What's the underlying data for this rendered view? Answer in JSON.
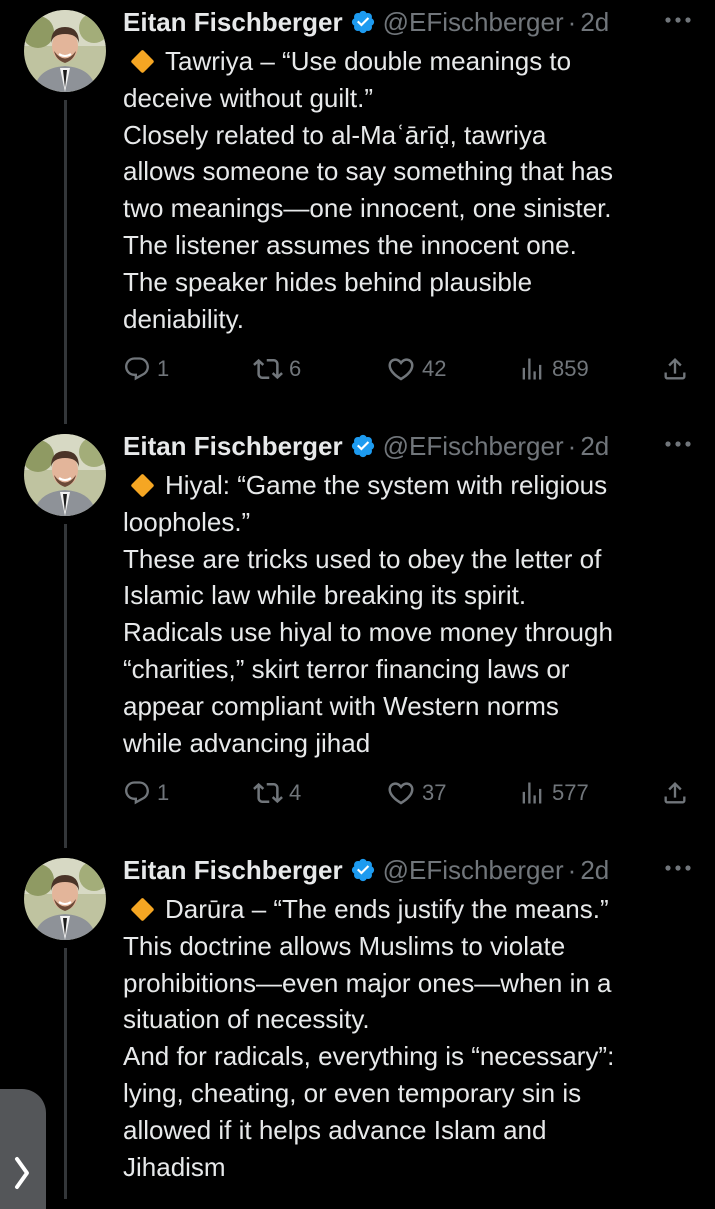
{
  "tweets": [
    {
      "author": {
        "name": "Eitan Fischberger",
        "handle": "@EFischberger",
        "time": "2d"
      },
      "lines": [
        "Tawriya – “Use double meanings to",
        "deceive without guilt.”",
        "Closely related to al-Maʿārīḍ, tawriya",
        "allows someone to say something that has",
        "two meanings—one innocent, one sinister.",
        "The listener assumes the innocent one.",
        "The speaker hides behind plausible",
        "deniability."
      ],
      "stats": {
        "replies": "1",
        "reposts": "6",
        "likes": "42",
        "views": "859"
      }
    },
    {
      "author": {
        "name": "Eitan Fischberger",
        "handle": "@EFischberger",
        "time": "2d"
      },
      "lines": [
        "Hiyal: “Game the system with religious",
        "loopholes.”",
        "These are tricks used to obey the letter of",
        "Islamic law while breaking its spirit.",
        "Radicals use hiyal to move money through",
        "“charities,” skirt terror financing laws or",
        "appear compliant with Western norms",
        "while advancing jihad"
      ],
      "stats": {
        "replies": "1",
        "reposts": "4",
        "likes": "37",
        "views": "577"
      }
    },
    {
      "author": {
        "name": "Eitan Fischberger",
        "handle": "@EFischberger",
        "time": "2d"
      },
      "lines": [
        "Darūra – “The ends justify the means.”",
        "This doctrine allows Muslims to violate",
        "prohibitions—even major ones—when in a",
        "situation of necessity.",
        "And for radicals, everything is “necessary”:",
        "lying, cheating, or even temporary sin is",
        "allowed if it helps advance Islam and",
        "Jihadism"
      ]
    }
  ],
  "colors": {
    "background": "#000000",
    "text": "#e7e9ea",
    "muted": "#71767b",
    "verified": "#1d9bf0",
    "diamond": "#f5a623",
    "thread_line": "#333639"
  },
  "icons": [
    "verified-badge-icon",
    "more-icon",
    "diamond-icon",
    "reply-icon",
    "repost-icon",
    "like-icon",
    "views-icon",
    "share-icon",
    "chevron-right-icon"
  ]
}
